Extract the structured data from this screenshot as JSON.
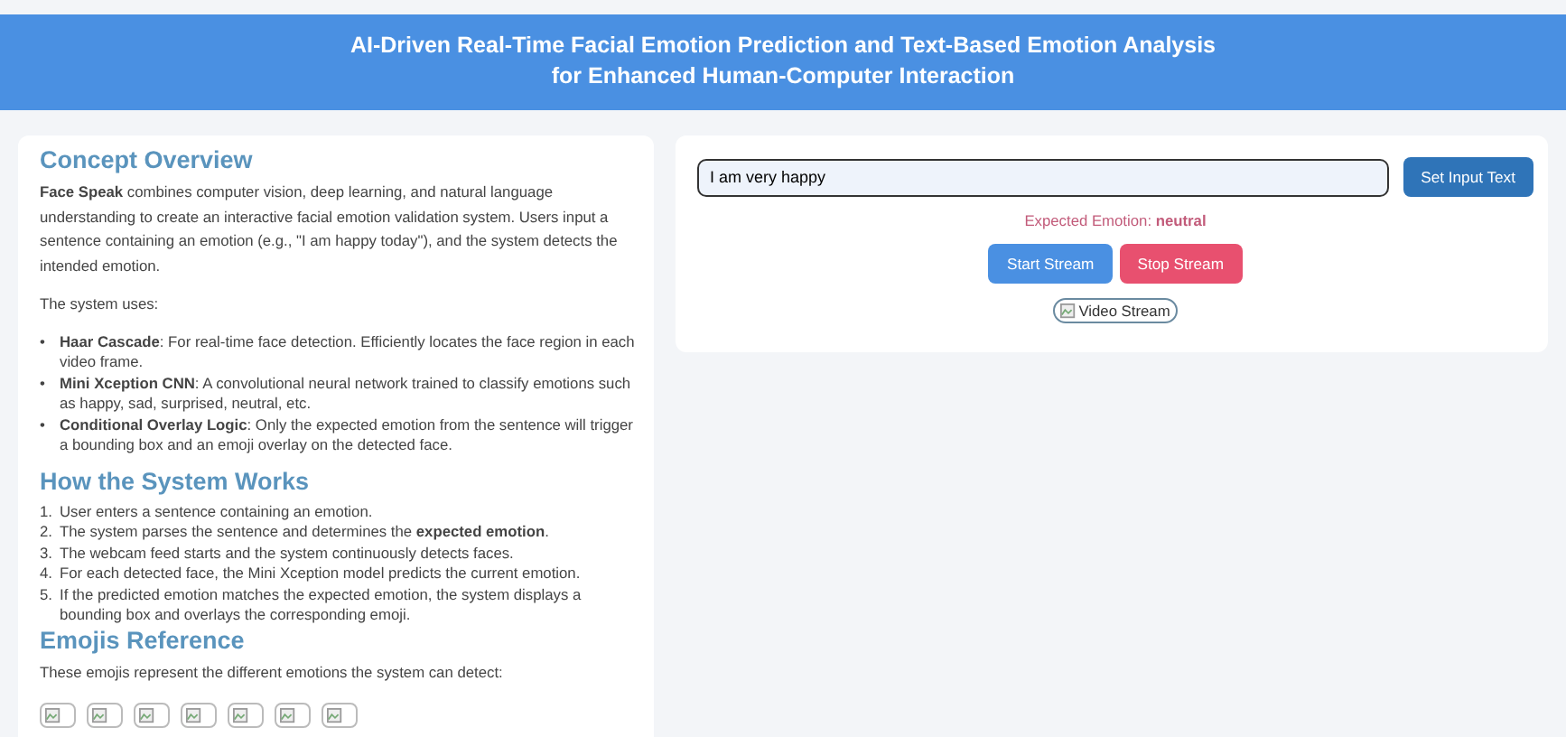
{
  "header": {
    "title_lines": [
      "AI-Driven Real-Time Facial Emotion Prediction and Text-Based Emotion Analysis",
      "for Enhanced Human-Computer Interaction"
    ]
  },
  "concept": {
    "heading": "Concept Overview",
    "intro": "**Face Speak** combines computer vision, deep learning, and natural language understanding to create an interactive facial emotion validation system. Users input a sentence containing an emotion (e.g., \"I am happy today\"), and the system detects the intended emotion.",
    "uses_label": "The system uses:",
    "uses": [
      {
        "marker": "•",
        "text": "**Haar Cascade**: For real-time face detection. Efficiently locates the face region in each video frame."
      },
      {
        "marker": "•",
        "text": "**Mini Xception CNN**: A convolutional neural network trained to classify emotions such as happy, sad, surprised, neutral, etc."
      },
      {
        "marker": "•",
        "text": "**Conditional Overlay Logic**: Only the expected emotion from the sentence will trigger a bounding box and an emoji overlay on the detected face."
      }
    ]
  },
  "how": {
    "heading": "How the System Works",
    "steps": [
      {
        "marker": "1.",
        "text": "User enters a sentence containing an emotion."
      },
      {
        "marker": "2.",
        "text": "The system parses the sentence and determines the **expected emotion**."
      },
      {
        "marker": "3.",
        "text": "The webcam feed starts and the system continuously detects faces."
      },
      {
        "marker": "4.",
        "text": "For each detected face, the Mini Xception model predicts the current emotion."
      },
      {
        "marker": "5.",
        "text": "If the predicted emotion matches the expected emotion, the system displays a bounding box and overlays the corresponding emoji."
      }
    ]
  },
  "emojis": {
    "heading": "Emojis Reference",
    "description": "These emojis represent the different emotions the system can detect:",
    "images": [
      {
        "kind": "broken-image"
      },
      {
        "kind": "broken-image"
      },
      {
        "kind": "broken-image"
      },
      {
        "kind": "broken-image"
      },
      {
        "kind": "broken-image"
      },
      {
        "kind": "broken-image"
      },
      {
        "kind": "broken-image"
      }
    ]
  },
  "control": {
    "input_value": "I am very happy",
    "set_button": "Set Input Text",
    "expected": "Expected Emotion: **neutral**",
    "start_button": "Start Stream",
    "stop_button": "Stop Stream",
    "video_alt": "Video Stream"
  }
}
